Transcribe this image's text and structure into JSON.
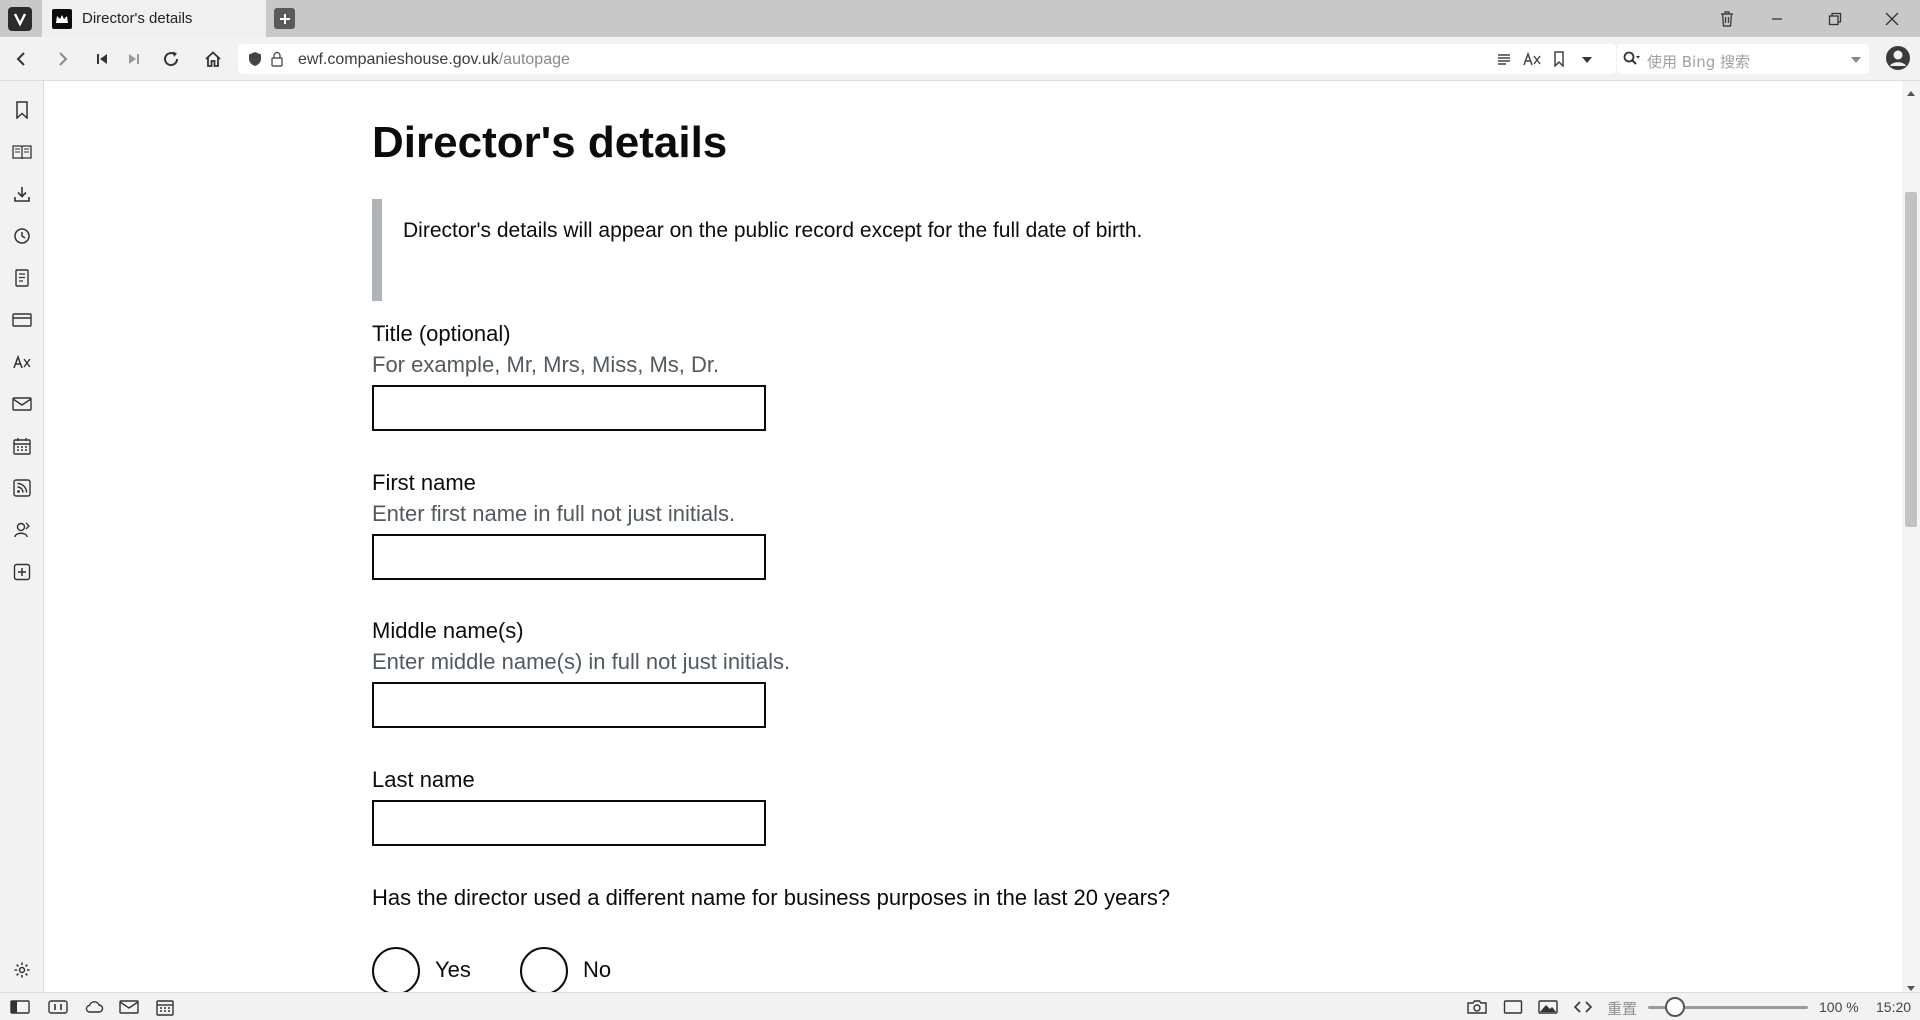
{
  "browser": {
    "tab_title": "Director's details",
    "address": {
      "host": "ewf.companieshouse.gov.uk",
      "path": "/autopage"
    },
    "search_placeholder": "使用 Bing 搜索",
    "zoom_reset_label": "重置",
    "zoom_level": "100 %",
    "zoom_fraction": 0.17,
    "clock": "15:20"
  },
  "page": {
    "title": "Director's details",
    "inset_text": "Director's details will appear on the public record except for the full date of birth.",
    "fields": {
      "title": {
        "label": "Title (optional)",
        "hint": "For example, Mr, Mrs, Miss, Ms, Dr.",
        "value": ""
      },
      "first_name": {
        "label": "First name",
        "hint": "Enter first name in full not just initials.",
        "value": ""
      },
      "middle_name": {
        "label": "Middle name(s)",
        "hint": "Enter middle name(s) in full not just initials.",
        "value": ""
      },
      "last_name": {
        "label": "Last name",
        "value": ""
      }
    },
    "question": "Has the director used a different name for business purposes in the last 20 years?",
    "options": {
      "yes": "Yes",
      "no": "No"
    }
  },
  "icons": {
    "tabbar": [
      "vivaldi-logo-icon",
      "crown-favicon-icon",
      "new-tab-icon",
      "trash-icon",
      "minimize-icon",
      "restore-icon",
      "close-icon"
    ],
    "navbar": [
      "back-icon",
      "forward-icon",
      "rewind-icon",
      "fast-forward-icon",
      "reload-icon",
      "home-icon",
      "shield-icon",
      "lock-icon",
      "reader-view-icon",
      "translate-icon",
      "bookmark-icon",
      "chevron-down-icon",
      "search-icon",
      "profile-icon"
    ],
    "sidepanel": [
      "bookmarks-icon",
      "reading-list-icon",
      "downloads-icon",
      "history-icon",
      "notes-icon",
      "window-icon",
      "translate-icon",
      "mail-icon",
      "calendar-icon",
      "feeds-icon",
      "contacts-icon",
      "add-panel-icon",
      "settings-icon"
    ],
    "statusbar": [
      "panel-toggle-icon",
      "tab-tiling-icon",
      "sync-cloud-icon",
      "mail-icon",
      "calendar-icon",
      "capture-icon",
      "window-icon",
      "image-icon",
      "code-icon"
    ]
  },
  "colors": {
    "text": "#0b0c0c",
    "hint": "#505a5f",
    "inset_border": "#b1b4b6"
  }
}
